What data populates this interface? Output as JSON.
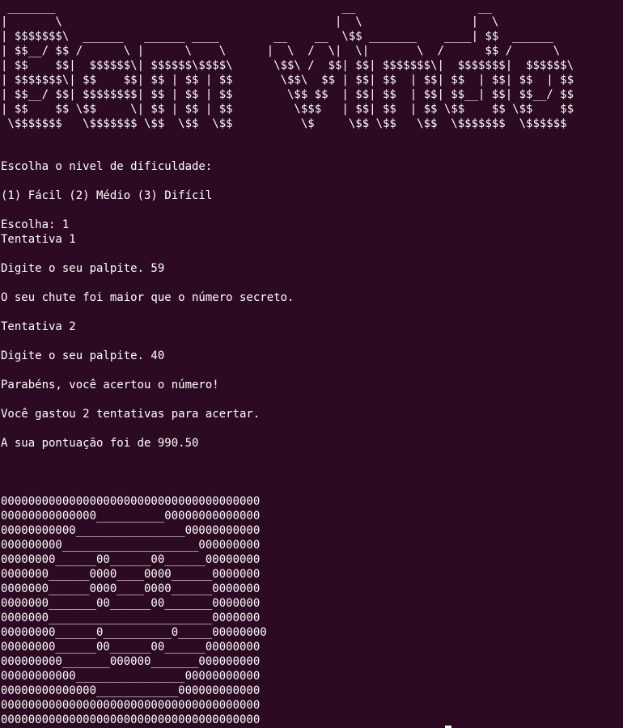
{
  "colors": {
    "background": "#2c0a23",
    "foreground": "#ffffff"
  },
  "banner_lines": [
    " _______                                          __                  __",
    "|       \\                                        |  \\                |  \\",
    "| $$$$$$$\\  ______   ______ ____        __    __  \\$$ _______    ____| $$  ______",
    "| $$__/ $$ /      \\ |      \\    \\      |  \\  /  \\|  \\|       \\  /      $$ /      \\",
    "| $$    $$|  $$$$$$\\| $$$$$$\\$$$$\\      \\$$\\ /  $$| $$| $$$$$$$\\|  $$$$$$$|  $$$$$$\\",
    "| $$$$$$$\\| $$    $$| $$ | $$ | $$       \\$$\\  $$ | $$| $$  | $$| $$  | $$| $$  | $$",
    "| $$__/ $$| $$$$$$$$| $$ | $$ | $$        \\$$ $$  | $$| $$  | $$| $$__| $$| $$__/ $$",
    "| $$    $$ \\$$     \\| $$ | $$ | $$         \\$$$   | $$| $$  | $$ \\$$    $$ \\$$    $$",
    " \\$$$$$$$   \\$$$$$$$ \\$$  \\$$  \\$$          \\$     \\$$ \\$$   \\$$  \\$$$$$$$  \\$$$$$$"
  ],
  "game_lines": [
    "Escolha o nivel de dificuldade:",
    "(1) Fácil (2) Médio (3) Difícil",
    "Escolha: 1",
    "Tentativa 1",
    "Digite o seu palpite. 59",
    "O seu chute foi maior que o número secreto.",
    "Tentativa 2",
    "Digite o seu palpite. 40",
    "Parabéns, você acertou o número!",
    "Você gastou 2 tentativas para acertar.",
    "A sua pontuação foi de 990.50"
  ],
  "art_lines": [
    "00000000000000000000000000000000000000",
    "00000000000000__________00000000000000",
    "00000000000________________00000000000",
    "000000000____________________000000000",
    "00000000______00______00______00000000",
    "0000000______0000____0000______0000000",
    "0000000______0000____0000______0000000",
    "0000000_______00______00_______0000000",
    "0000000________________________0000000",
    "00000000______0__________0_____00000000",
    "00000000______00______00______00000000",
    "000000000_______000000_______000000000",
    "00000000000________________00000000000",
    "00000000000000____________000000000000",
    "00000000000000000000000000000000000000",
    "00000000000000000000000000000000000000"
  ]
}
